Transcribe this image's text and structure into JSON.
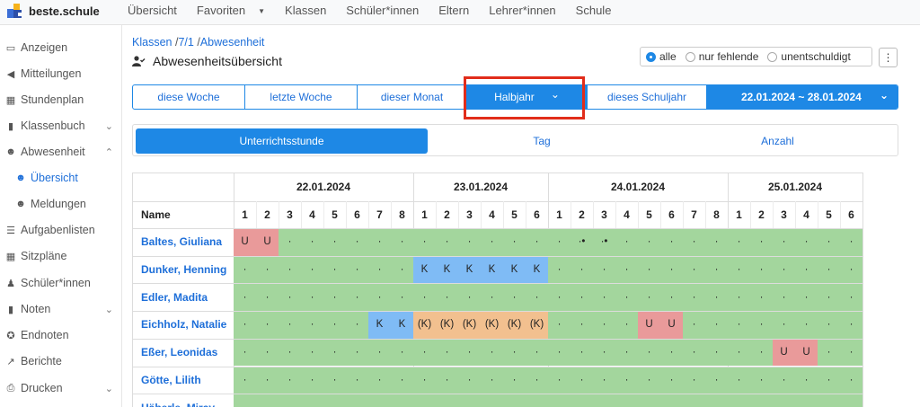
{
  "brand": {
    "name": "beste.schule"
  },
  "topnav": [
    {
      "label": "Übersicht"
    },
    {
      "label": "Favoriten",
      "dropdown": true
    },
    {
      "label": "Klassen"
    },
    {
      "label": "Schüler*innen"
    },
    {
      "label": "Eltern"
    },
    {
      "label": "Lehrer*innen"
    },
    {
      "label": "Schule"
    }
  ],
  "sidebar": [
    {
      "label": "Anzeigen",
      "icon": "monitor-icon",
      "glyph": "▭"
    },
    {
      "label": "Mitteilungen",
      "icon": "megaphone-icon",
      "glyph": "◀"
    },
    {
      "label": "Stundenplan",
      "icon": "calendar-icon",
      "glyph": "▦"
    },
    {
      "label": "Klassenbuch",
      "icon": "book-icon",
      "glyph": "▮",
      "chevron": "⌄"
    },
    {
      "label": "Abwesenheit",
      "icon": "user-check-icon",
      "glyph": "☻",
      "chevron": "⌃"
    },
    {
      "label": "Übersicht",
      "icon": "user-check-icon",
      "glyph": "☻",
      "sub": true,
      "active": true
    },
    {
      "label": "Meldungen",
      "icon": "user-check-icon",
      "glyph": "☻",
      "sub": true
    },
    {
      "label": "Aufgabenlisten",
      "icon": "list-icon",
      "glyph": "☰"
    },
    {
      "label": "Sitzpläne",
      "icon": "grid-icon",
      "glyph": "▦"
    },
    {
      "label": "Schüler*innen",
      "icon": "person-icon",
      "glyph": "♟"
    },
    {
      "label": "Noten",
      "icon": "book-icon",
      "glyph": "▮",
      "chevron": "⌄"
    },
    {
      "label": "Endnoten",
      "icon": "award-icon",
      "glyph": "✪"
    },
    {
      "label": "Berichte",
      "icon": "chart-icon",
      "glyph": "↗"
    },
    {
      "label": "Drucken",
      "icon": "printer-icon",
      "glyph": "⎙",
      "chevron": "⌄"
    }
  ],
  "breadcrumb": {
    "a": "Klassen",
    "b": "7/1",
    "c": "Abwesenheit",
    "sep": "/"
  },
  "title": "Abwesenheitsübersicht",
  "filter": {
    "options": [
      "alle",
      "nur fehlende",
      "unentschuldigt"
    ],
    "selected": "alle"
  },
  "more_label": "⋮",
  "periods": [
    {
      "label": "diese Woche"
    },
    {
      "label": "letzte Woche"
    },
    {
      "label": "dieser Monat"
    },
    {
      "label": "Halbjahr",
      "selected": true,
      "chevron": "⌄"
    },
    {
      "label": "dieses Schuljahr"
    },
    {
      "label": "22.01.2024 ~ 28.01.2024",
      "chevron": "⌄"
    }
  ],
  "modes": [
    {
      "label": "Unterrichtsstunde",
      "selected": true
    },
    {
      "label": "Tag"
    },
    {
      "label": "Anzahl"
    }
  ],
  "table": {
    "name_header": "Name",
    "days": [
      {
        "date": "22.01.2024",
        "lessons": [
          1,
          2,
          3,
          4,
          5,
          6,
          7,
          8
        ]
      },
      {
        "date": "23.01.2024",
        "lessons": [
          1,
          2,
          3,
          4,
          5,
          6
        ]
      },
      {
        "date": "24.01.2024",
        "lessons": [
          1,
          2,
          3,
          4,
          5,
          6,
          7,
          8
        ]
      },
      {
        "date": "25.01.2024",
        "lessons": [
          1,
          2,
          3,
          4,
          5,
          6
        ]
      }
    ],
    "rows": [
      {
        "name": "Baltes, Giuliana",
        "cells": [
          [
            "r",
            "U"
          ],
          [
            "r",
            "U"
          ],
          [
            "g",
            "·"
          ],
          [
            "g",
            "·"
          ],
          [
            "g",
            "·"
          ],
          [
            "g",
            "·"
          ],
          [
            "g",
            "·"
          ],
          [
            "g",
            "·"
          ],
          [
            "g",
            "·"
          ],
          [
            "g",
            "·"
          ],
          [
            "g",
            "·"
          ],
          [
            "g",
            "·"
          ],
          [
            "g",
            "·"
          ],
          [
            "g",
            "·"
          ],
          [
            "g",
            "·"
          ],
          [
            "g",
            "·•"
          ],
          [
            "g",
            "·•"
          ],
          [
            "g",
            "·"
          ],
          [
            "g",
            "·"
          ],
          [
            "g",
            "·"
          ],
          [
            "g",
            "·"
          ],
          [
            "g",
            "·"
          ],
          [
            "g",
            "·"
          ],
          [
            "g",
            "·"
          ],
          [
            "g",
            "·"
          ],
          [
            "g",
            "·"
          ],
          [
            "g",
            "·"
          ],
          [
            "g",
            "·"
          ]
        ]
      },
      {
        "name": "Dunker, Henning",
        "cells": [
          [
            "g",
            "·"
          ],
          [
            "g",
            "·"
          ],
          [
            "g",
            "·"
          ],
          [
            "g",
            "·"
          ],
          [
            "g",
            "·"
          ],
          [
            "g",
            "·"
          ],
          [
            "g",
            "·"
          ],
          [
            "g",
            "·"
          ],
          [
            "b",
            "K"
          ],
          [
            "b",
            "K"
          ],
          [
            "b",
            "K"
          ],
          [
            "b",
            "K"
          ],
          [
            "b",
            "K"
          ],
          [
            "b",
            "K"
          ],
          [
            "g",
            "·"
          ],
          [
            "g",
            "·"
          ],
          [
            "g",
            "·"
          ],
          [
            "g",
            "·"
          ],
          [
            "g",
            "·"
          ],
          [
            "g",
            "·"
          ],
          [
            "g",
            "·"
          ],
          [
            "g",
            "·"
          ],
          [
            "g",
            "·"
          ],
          [
            "g",
            "·"
          ],
          [
            "g",
            "·"
          ],
          [
            "g",
            "·"
          ],
          [
            "g",
            "·"
          ],
          [
            "g",
            "·"
          ]
        ]
      },
      {
        "name": "Edler, Madita",
        "cells": [
          [
            "g",
            "·"
          ],
          [
            "g",
            "·"
          ],
          [
            "g",
            "·"
          ],
          [
            "g",
            "·"
          ],
          [
            "g",
            "·"
          ],
          [
            "g",
            "·"
          ],
          [
            "g",
            "·"
          ],
          [
            "g",
            "·"
          ],
          [
            "g",
            "·"
          ],
          [
            "g",
            "·"
          ],
          [
            "g",
            "·"
          ],
          [
            "g",
            "·"
          ],
          [
            "g",
            "·"
          ],
          [
            "g",
            "·"
          ],
          [
            "g",
            "·"
          ],
          [
            "g",
            "·"
          ],
          [
            "g",
            "·"
          ],
          [
            "g",
            "·"
          ],
          [
            "g",
            "·"
          ],
          [
            "g",
            "·"
          ],
          [
            "g",
            "·"
          ],
          [
            "g",
            "·"
          ],
          [
            "g",
            "·"
          ],
          [
            "g",
            "·"
          ],
          [
            "g",
            "·"
          ],
          [
            "g",
            "·"
          ],
          [
            "g",
            "·"
          ],
          [
            "g",
            "·"
          ]
        ]
      },
      {
        "name": "Eichholz, Natalie",
        "cells": [
          [
            "g",
            "·"
          ],
          [
            "g",
            "·"
          ],
          [
            "g",
            "·"
          ],
          [
            "g",
            "·"
          ],
          [
            "g",
            "·"
          ],
          [
            "g",
            "·"
          ],
          [
            "b",
            "K"
          ],
          [
            "b",
            "K"
          ],
          [
            "o",
            "(K)"
          ],
          [
            "o",
            "(K)"
          ],
          [
            "o",
            "(K)"
          ],
          [
            "o",
            "(K)"
          ],
          [
            "o",
            "(K)"
          ],
          [
            "o",
            "(K)"
          ],
          [
            "g",
            "·"
          ],
          [
            "g",
            "·"
          ],
          [
            "g",
            "·"
          ],
          [
            "g",
            "·"
          ],
          [
            "r",
            "U"
          ],
          [
            "r",
            "U"
          ],
          [
            "g",
            "·"
          ],
          [
            "g",
            "·"
          ],
          [
            "g",
            "·"
          ],
          [
            "g",
            "·"
          ],
          [
            "g",
            "·"
          ],
          [
            "g",
            "·"
          ],
          [
            "g",
            "·"
          ],
          [
            "g",
            "·"
          ]
        ]
      },
      {
        "name": "Eßer, Leonidas",
        "cells": [
          [
            "g",
            "·"
          ],
          [
            "g",
            "·"
          ],
          [
            "g",
            "·"
          ],
          [
            "g",
            "·"
          ],
          [
            "g",
            "·"
          ],
          [
            "g",
            "·"
          ],
          [
            "g",
            "·"
          ],
          [
            "g",
            "·"
          ],
          [
            "g",
            "·"
          ],
          [
            "g",
            "·"
          ],
          [
            "g",
            "·"
          ],
          [
            "g",
            "·"
          ],
          [
            "g",
            "·"
          ],
          [
            "g",
            "·"
          ],
          [
            "g",
            "·"
          ],
          [
            "g",
            "·"
          ],
          [
            "g",
            "·"
          ],
          [
            "g",
            "·"
          ],
          [
            "g",
            "·"
          ],
          [
            "g",
            "·"
          ],
          [
            "g",
            "·"
          ],
          [
            "g",
            "·"
          ],
          [
            "g",
            "·"
          ],
          [
            "g",
            "·"
          ],
          [
            "r",
            "U"
          ],
          [
            "r",
            "U"
          ],
          [
            "g",
            "·"
          ],
          [
            "g",
            "·"
          ]
        ]
      },
      {
        "name": "Götte, Lilith",
        "cells": [
          [
            "g",
            "·"
          ],
          [
            "g",
            "·"
          ],
          [
            "g",
            "·"
          ],
          [
            "g",
            "·"
          ],
          [
            "g",
            "·"
          ],
          [
            "g",
            "·"
          ],
          [
            "g",
            "·"
          ],
          [
            "g",
            "·"
          ],
          [
            "g",
            "·"
          ],
          [
            "g",
            "·"
          ],
          [
            "g",
            "·"
          ],
          [
            "g",
            "·"
          ],
          [
            "g",
            "·"
          ],
          [
            "g",
            "·"
          ],
          [
            "g",
            "·"
          ],
          [
            "g",
            "·"
          ],
          [
            "g",
            "·"
          ],
          [
            "g",
            "·"
          ],
          [
            "g",
            "·"
          ],
          [
            "g",
            "·"
          ],
          [
            "g",
            "·"
          ],
          [
            "g",
            "·"
          ],
          [
            "g",
            "·"
          ],
          [
            "g",
            "·"
          ],
          [
            "g",
            "·"
          ],
          [
            "g",
            "·"
          ],
          [
            "g",
            "·"
          ],
          [
            "g",
            "·"
          ]
        ]
      },
      {
        "name": "Häberle, Mirav",
        "cells": [
          [
            "g",
            ""
          ],
          [
            "g",
            ""
          ],
          [
            "g",
            ""
          ],
          [
            "g",
            ""
          ],
          [
            "g",
            ""
          ],
          [
            "g",
            ""
          ],
          [
            "g",
            ""
          ],
          [
            "g",
            ""
          ],
          [
            "g",
            ""
          ],
          [
            "g",
            ""
          ],
          [
            "g",
            ""
          ],
          [
            "g",
            ""
          ],
          [
            "g",
            ""
          ],
          [
            "g",
            ""
          ],
          [
            "g",
            ""
          ],
          [
            "g",
            ""
          ],
          [
            "g",
            ""
          ],
          [
            "g",
            ""
          ],
          [
            "g",
            ""
          ],
          [
            "g",
            ""
          ],
          [
            "g",
            ""
          ],
          [
            "g",
            ""
          ],
          [
            "g",
            ""
          ],
          [
            "g",
            ""
          ],
          [
            "g",
            ""
          ],
          [
            "g",
            ""
          ],
          [
            "g",
            ""
          ],
          [
            "g",
            ""
          ]
        ]
      }
    ]
  },
  "colors": {
    "accent": "#1e88e5",
    "present": "#a3d69d",
    "unexcused": "#e99a9a",
    "sick": "#7fbbf5",
    "sick_partial": "#f2c08f",
    "highlight": "#e12d1b"
  }
}
